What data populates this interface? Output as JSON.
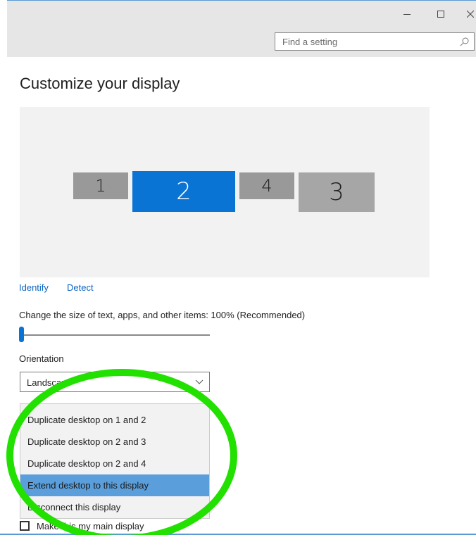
{
  "window": {
    "minimize_label": "−",
    "maximize_label": "☐",
    "close_label": "×",
    "search": {
      "placeholder": "Find a setting"
    }
  },
  "page_title": "Customize your display",
  "monitors": [
    {
      "label": "1",
      "selected": false
    },
    {
      "label": "2",
      "selected": true
    },
    {
      "label": "4",
      "selected": false
    },
    {
      "label": "3",
      "selected": false
    }
  ],
  "links": {
    "identify": "Identify",
    "detect": "Detect"
  },
  "scale": {
    "label": "Change the size of text, apps, and other items: 100% (Recommended)",
    "value_percent": 100,
    "slider_fraction": 0.0
  },
  "orientation": {
    "label": "Orientation",
    "value": "Landscape"
  },
  "multiple_displays_menu": {
    "items": [
      "Duplicate desktop on 1 and 2",
      "Duplicate desktop on 2 and 3",
      "Duplicate desktop on 2 and 4",
      "Extend desktop to this display",
      "Disconnect this display"
    ],
    "selected_index": 3
  },
  "main_display_checkbox": {
    "label": "Make this my main display",
    "checked": false
  },
  "colors": {
    "accent": "#0a74d4",
    "highlight_item": "#5a9fdb",
    "annotation_circle": "#22e000"
  }
}
